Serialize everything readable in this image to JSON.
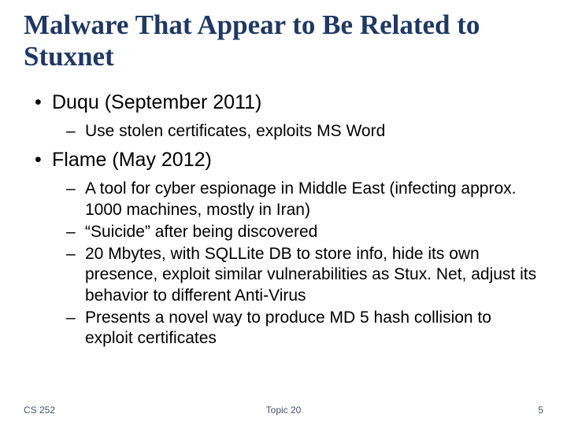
{
  "title": "Malware That Appear to Be Related to Stuxnet",
  "bullets": [
    {
      "text": "Duqu (September 2011)",
      "sub": [
        "Use stolen certificates, exploits MS Word"
      ]
    },
    {
      "text": "Flame (May 2012)",
      "sub": [
        "A tool for cyber espionage in Middle East (infecting approx. 1000 machines, mostly in Iran)",
        "“Suicide” after being discovered",
        "20 Mbytes, with SQLLite DB to store info, hide its own presence, exploit similar vulnerabilities as Stux. Net, adjust its behavior to different Anti-Virus",
        "Presents a novel way to produce MD 5 hash collision to exploit certificates"
      ]
    }
  ],
  "footer": {
    "left": "CS 252",
    "center": "Topic 20",
    "right": "5"
  }
}
